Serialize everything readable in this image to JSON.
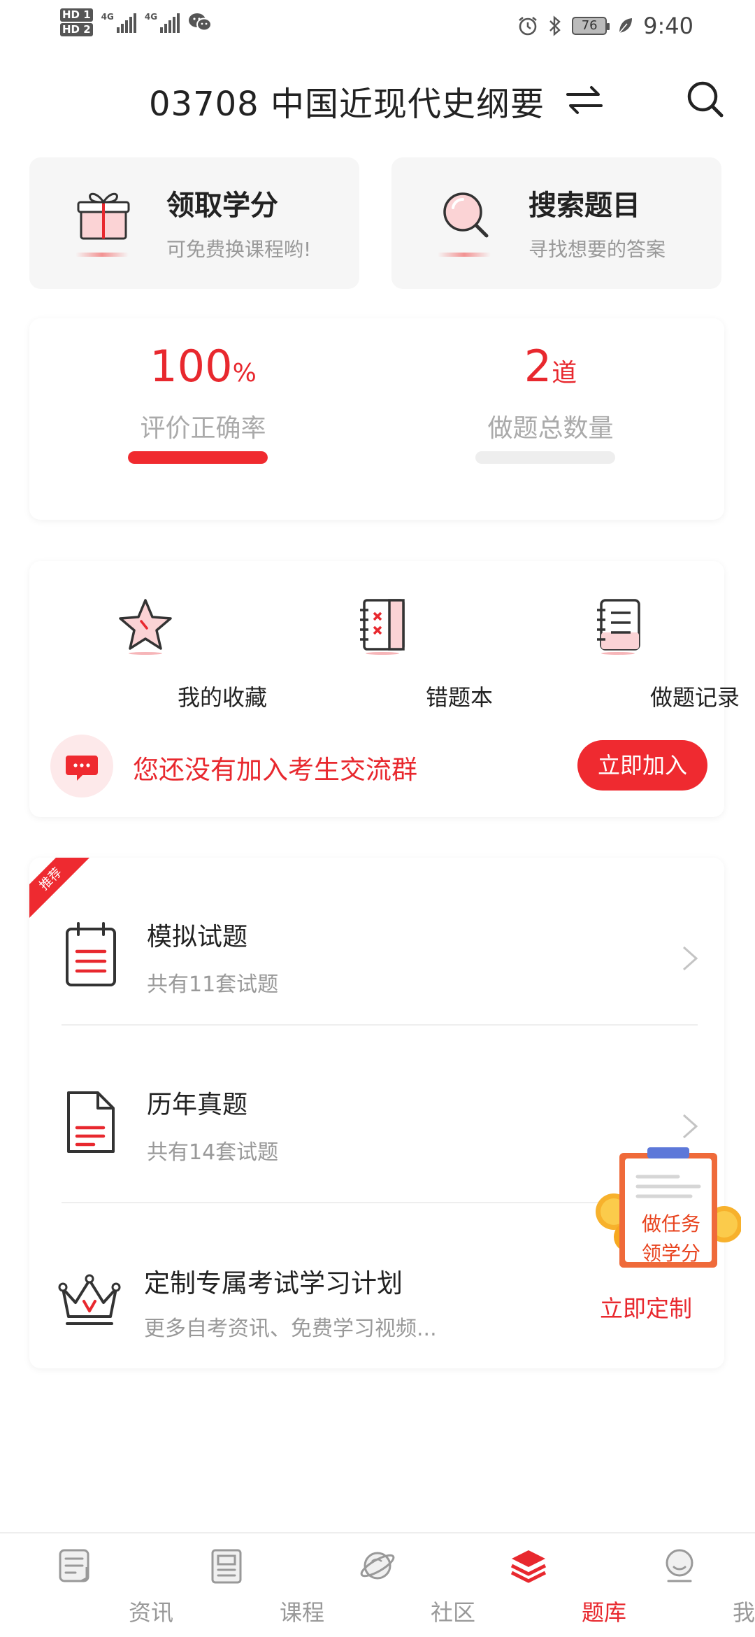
{
  "status_bar": {
    "hd1": "HD 1",
    "hd2": "HD 2",
    "net1": "4G",
    "net2": "4G",
    "battery": "76",
    "time": "9:40",
    "icons": [
      "alarm-icon",
      "bluetooth-icon",
      "leaf-icon",
      "wechat-icon"
    ]
  },
  "header": {
    "title": "03708 中国近现代史纲要",
    "icons": [
      "swap-icon",
      "search-icon"
    ]
  },
  "quick_cards": [
    {
      "title": "领取学分",
      "subtitle": "可免费换课程哟!",
      "icon": "gift-icon"
    },
    {
      "title": "搜索题目",
      "subtitle": "寻找想要的答案",
      "icon": "magnifier-icon"
    }
  ],
  "stats": {
    "accuracy": {
      "value": "100",
      "unit": "%",
      "label": "评价正确率",
      "fill_fraction": 1.0
    },
    "total": {
      "value": "2",
      "unit": "道",
      "label": "做题总数量",
      "fill_fraction": 0.0
    }
  },
  "tools": {
    "items": [
      {
        "label": "我的收藏",
        "icon": "star-icon"
      },
      {
        "label": "错题本",
        "icon": "mistake-book-icon"
      },
      {
        "label": "做题记录",
        "icon": "record-book-icon"
      }
    ],
    "join_text": "您还没有加入考生交流群",
    "join_button": "立即加入"
  },
  "list": {
    "ribbon": "推荐",
    "rows": [
      {
        "title": "模拟试题",
        "subtitle": "共有11套试题",
        "icon": "clipboard-icon"
      },
      {
        "title": "历年真题",
        "subtitle": "共有14套试题",
        "icon": "document-icon"
      }
    ],
    "plan": {
      "title": "定制专属考试学习计划",
      "subtitle": "更多自考资讯、免费学习视频...",
      "link": "立即定制",
      "icon": "crown-icon"
    }
  },
  "promo": {
    "line1": "做任务",
    "line2": "领学分"
  },
  "bottom_nav": [
    {
      "label": "资讯",
      "icon": "news-icon",
      "active": false
    },
    {
      "label": "课程",
      "icon": "course-icon",
      "active": false
    },
    {
      "label": "社区",
      "icon": "planet-icon",
      "active": false
    },
    {
      "label": "题库",
      "icon": "layers-icon",
      "active": true
    },
    {
      "label": "我的",
      "icon": "profile-icon",
      "active": false
    }
  ],
  "colors": {
    "accent": "#e8282e",
    "muted_text": "#999999",
    "card_bg": "#f6f6f6"
  }
}
